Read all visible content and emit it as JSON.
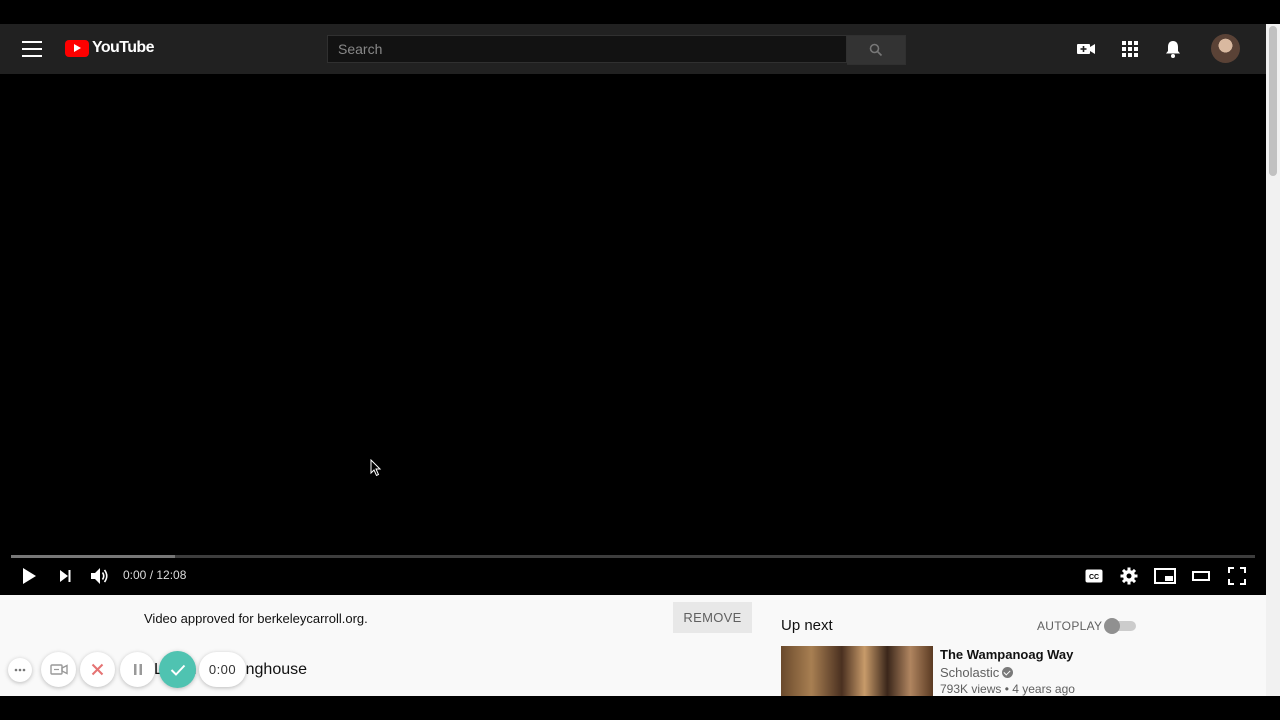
{
  "masthead": {
    "logo_text": "YouTube",
    "search_placeholder": "Search"
  },
  "player": {
    "time": "0:00 / 12:08",
    "progress_fraction": 0.0,
    "buffered_fraction": 0.132
  },
  "below_player": {
    "approved_text": "Video approved for berkeleycarroll.org.",
    "remove_label": "REMOVE",
    "title": "Life in the Longhouse",
    "meta": ""
  },
  "sidebar": {
    "up_next": "Up next",
    "autoplay_label": "AUTOPLAY",
    "recommendation": {
      "title": "The Wampanoag Way",
      "channel": "Scholastic",
      "meta": "793K views • 4 years ago"
    }
  },
  "recording_toolbar": {
    "timer": "0:00"
  },
  "colors": {
    "masthead_bg": "#212121",
    "logo_red": "#ff0000",
    "confirm_teal": "#4fc3b1",
    "cancel_red": "#e57373"
  }
}
